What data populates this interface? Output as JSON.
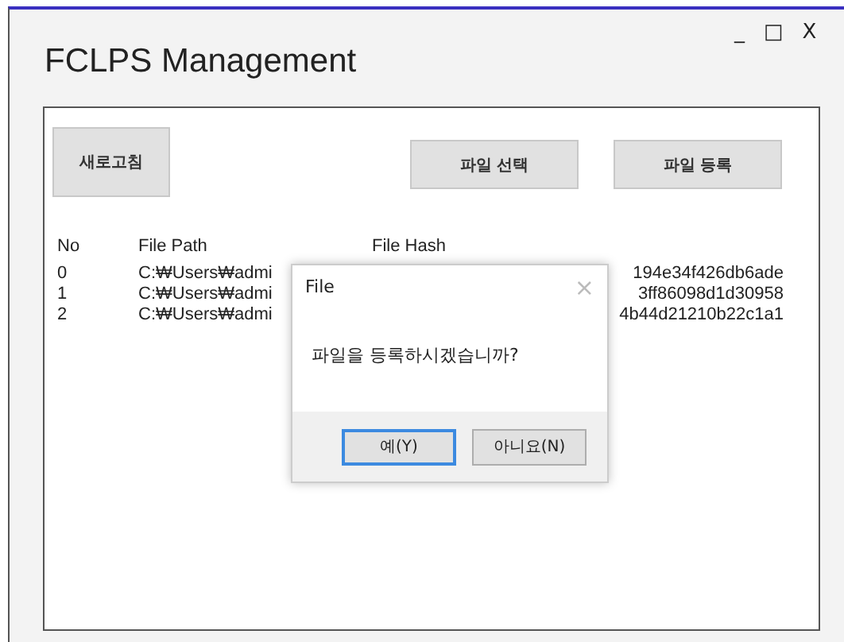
{
  "window": {
    "title": "FCLPS Management",
    "controls": [
      "_",
      "□",
      "X"
    ]
  },
  "buttons": [
    {
      "label": "새로고침"
    },
    {
      "label": "파일 선택"
    },
    {
      "label": "파일 등록"
    }
  ],
  "table": {
    "columns": [
      "No",
      "File Path",
      "File Hash"
    ],
    "rows": [
      {
        "no": "0",
        "path": "C:₩Users₩admi",
        "hash": "194e34f426db6ade"
      },
      {
        "no": "1",
        "path": "C:₩Users₩admi",
        "hash": "3ff86098d1d30958"
      },
      {
        "no": "2",
        "path": "C:₩Users₩admi",
        "hash": "4b44d21210b22c1a1"
      }
    ]
  },
  "dialog": {
    "title": "File",
    "close": "×",
    "message": "파일을 등록하시겠습니까?",
    "buttons": [
      {
        "label": "예(Y)",
        "selected": true
      },
      {
        "label": "아니요(N)",
        "selected": false
      }
    ]
  }
}
